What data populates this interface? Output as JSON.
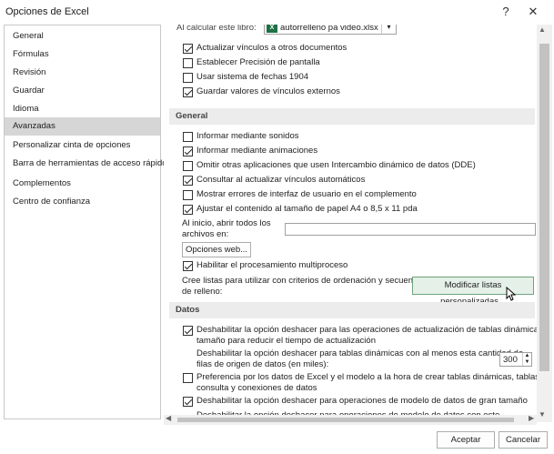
{
  "window": {
    "title": "Opciones de Excel",
    "help_label": "?",
    "close_label": "✕"
  },
  "sidebar": {
    "items": [
      {
        "label": "General"
      },
      {
        "label": "Fórmulas"
      },
      {
        "label": "Revisión"
      },
      {
        "label": "Guardar"
      },
      {
        "label": "Idioma"
      },
      {
        "label": "Avanzadas",
        "selected": true
      },
      {
        "label": "Personalizar cinta de opciones"
      },
      {
        "label": "Barra de herramientas de acceso rápido"
      },
      {
        "label": "Complementos"
      },
      {
        "label": "Centro de confianza"
      }
    ]
  },
  "calc_section": {
    "label": "Al calcular este libro:",
    "workbook": "autorrelleno pa video.xlsx",
    "options": [
      {
        "label": "Actualizar vínculos a otros documentos",
        "checked": true
      },
      {
        "label": "Establecer Precisión de pantalla",
        "checked": false
      },
      {
        "label": "Usar sistema de fechas 1904",
        "checked": false
      },
      {
        "label": "Guardar valores de vínculos externos",
        "checked": true
      }
    ]
  },
  "general_section": {
    "title": "General",
    "options": [
      {
        "label": "Informar mediante sonidos",
        "checked": false
      },
      {
        "label": "Informar mediante animaciones",
        "checked": true
      },
      {
        "label": "Omitir otras aplicaciones que usen Intercambio dinámico de datos (DDE)",
        "checked": false
      },
      {
        "label": "Consultar al actualizar vínculos automáticos",
        "checked": true
      },
      {
        "label": "Mostrar errores de interfaz de usuario en el complemento",
        "checked": false
      },
      {
        "label": "Ajustar el contenido al tamaño de papel A4 o 8,5 x 11 pda",
        "checked": true
      }
    ],
    "startup_label_line1": "Al inicio, abrir todos los",
    "startup_label_line2": "archivos en:",
    "startup_value": "",
    "web_options_button": "Opciones web...",
    "multithread": {
      "label": "Habilitar el procesamiento multiproceso",
      "checked": true
    },
    "custom_lists_line1": "Cree listas para utilizar con criterios de ordenación y secuencias",
    "custom_lists_line2": "de relleno:",
    "custom_lists_button": "Modificar listas personalizadas..."
  },
  "data_section": {
    "title": "Datos",
    "option1_line1": "Deshabilitar la opción deshacer para las operaciones de actualización de tablas dinámicas de gran",
    "option1_line2": "tamaño para reducir el tiempo de actualización",
    "option1_checked": true,
    "rows_label_line1": "Deshabilitar la opción deshacer para tablas dinámicas con al menos esta cantidad de",
    "rows_label_line2": "filas de origen de datos (en miles):",
    "rows_value": "300",
    "option2_line1": "Preferencia por los datos de Excel y el modelo a la hora de crear tablas dinámicas, tablas de",
    "option2_line2": "consulta y conexiones de datos",
    "option2_checked": false,
    "option3": "Deshabilitar la opción deshacer para operaciones de modelo de datos de gran tamaño",
    "option3_checked": true,
    "option4_partial": "Deshabilitar la opción deshacer para operaciones de modelo de datos con este"
  },
  "footer": {
    "ok_button": "Aceptar",
    "cancel_button": "Cancelar"
  }
}
